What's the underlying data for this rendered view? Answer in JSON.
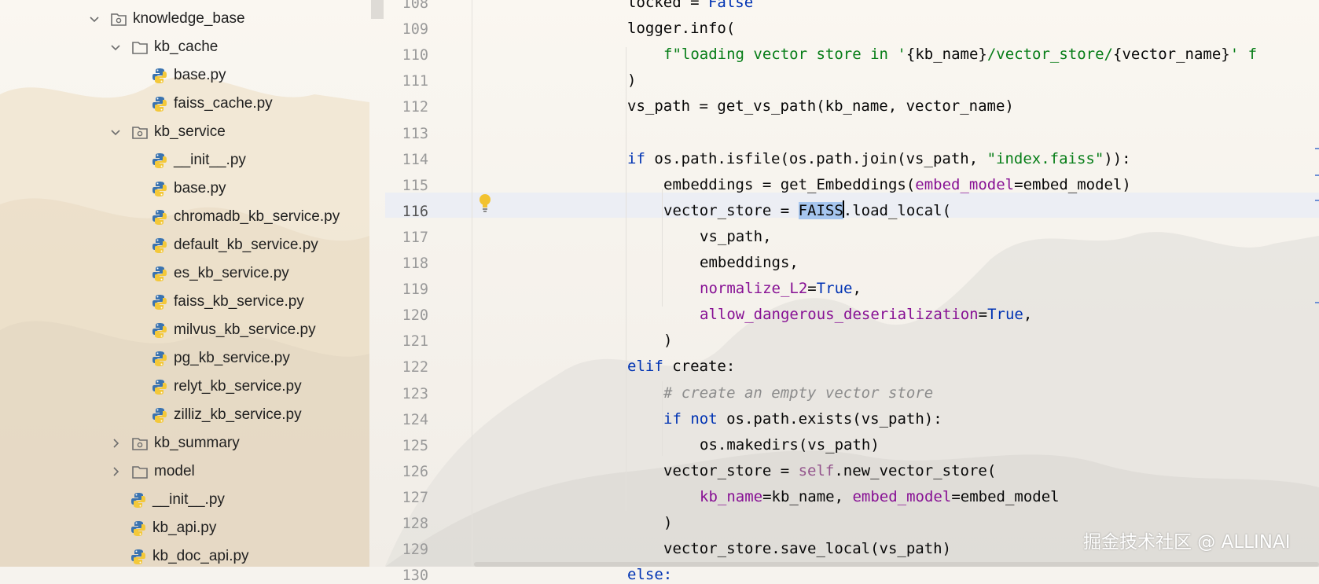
{
  "tree": {
    "items": [
      {
        "label": "knowledge_base",
        "type": "package",
        "chevron": "down"
      },
      {
        "label": "kb_cache",
        "type": "folder",
        "chevron": "down"
      },
      {
        "label": "base.py",
        "type": "python"
      },
      {
        "label": "faiss_cache.py",
        "type": "python"
      },
      {
        "label": "kb_service",
        "type": "package",
        "chevron": "down"
      },
      {
        "label": "__init__.py",
        "type": "python"
      },
      {
        "label": "base.py",
        "type": "python"
      },
      {
        "label": "chromadb_kb_service.py",
        "type": "python"
      },
      {
        "label": "default_kb_service.py",
        "type": "python"
      },
      {
        "label": "es_kb_service.py",
        "type": "python"
      },
      {
        "label": "faiss_kb_service.py",
        "type": "python"
      },
      {
        "label": "milvus_kb_service.py",
        "type": "python"
      },
      {
        "label": "pg_kb_service.py",
        "type": "python"
      },
      {
        "label": "relyt_kb_service.py",
        "type": "python"
      },
      {
        "label": "zilliz_kb_service.py",
        "type": "python"
      },
      {
        "label": "kb_summary",
        "type": "package",
        "chevron": "right"
      },
      {
        "label": "model",
        "type": "folder",
        "chevron": "right"
      },
      {
        "label": "__init__.py",
        "type": "python"
      },
      {
        "label": "kb_api.py",
        "type": "python"
      },
      {
        "label": "kb_doc_api.py",
        "type": "python"
      }
    ]
  },
  "editor": {
    "active_line": "116",
    "lines": [
      {
        "num": "108",
        "segs": [
          [
            "locked = ",
            ""
          ],
          [
            "False",
            "kw"
          ]
        ]
      },
      {
        "num": "109",
        "segs": [
          [
            "logger.info(",
            ""
          ]
        ]
      },
      {
        "num": "110",
        "segs": [
          [
            "f\"loading vector store in '",
            "str"
          ],
          [
            "{",
            ""
          ],
          [
            "kb_name",
            "plain"
          ],
          [
            "}",
            "plain"
          ],
          [
            "/vector_store/",
            "str"
          ],
          [
            "{",
            ""
          ],
          [
            "vector_name",
            "plain"
          ],
          [
            "}",
            "plain"
          ],
          [
            "' f",
            "str"
          ]
        ]
      },
      {
        "num": "111",
        "segs": [
          [
            ")",
            ""
          ]
        ]
      },
      {
        "num": "112",
        "segs": [
          [
            "vs_path = get_vs_path(kb_name, vector_name)",
            ""
          ]
        ]
      },
      {
        "num": "113",
        "segs": []
      },
      {
        "num": "114",
        "segs": [
          [
            "if",
            "kw"
          ],
          [
            " os.path.isfile(os.path.join(vs_path, ",
            ""
          ],
          [
            "\"index.faiss\"",
            "str"
          ],
          [
            ")):",
            ""
          ]
        ]
      },
      {
        "num": "115",
        "segs": [
          [
            "embeddings = get_Embeddings(",
            ""
          ],
          [
            "embed_model",
            "prm"
          ],
          [
            "=embed_model)",
            ""
          ]
        ]
      },
      {
        "num": "116",
        "segs": [
          [
            "vector_store = ",
            ""
          ],
          [
            "FAISS",
            "sel"
          ],
          [
            "|",
            "caret"
          ],
          [
            ".load_local(",
            ""
          ]
        ]
      },
      {
        "num": "117",
        "segs": [
          [
            "vs_path,",
            ""
          ]
        ]
      },
      {
        "num": "118",
        "segs": [
          [
            "embeddings,",
            ""
          ]
        ]
      },
      {
        "num": "119",
        "segs": [
          [
            "normalize_L2",
            "prm"
          ],
          [
            "=",
            ""
          ],
          [
            "True",
            "kw"
          ],
          [
            ",",
            ""
          ]
        ]
      },
      {
        "num": "120",
        "segs": [
          [
            "allow_dangerous_deserialization",
            "prm"
          ],
          [
            "=",
            ""
          ],
          [
            "True",
            "kw"
          ],
          [
            ",",
            ""
          ]
        ]
      },
      {
        "num": "121",
        "segs": [
          [
            ")",
            ""
          ]
        ]
      },
      {
        "num": "122",
        "segs": [
          [
            "elif",
            "kw"
          ],
          [
            " create:",
            ""
          ]
        ]
      },
      {
        "num": "123",
        "segs": [
          [
            "# create an empty vector store",
            "cmt"
          ]
        ]
      },
      {
        "num": "124",
        "segs": [
          [
            "if",
            "kw"
          ],
          [
            " ",
            ""
          ],
          [
            "not",
            "kw"
          ],
          [
            " os.path.exists(vs_path):",
            ""
          ]
        ]
      },
      {
        "num": "125",
        "segs": [
          [
            "os.makedirs(vs_path)",
            ""
          ]
        ]
      },
      {
        "num": "126",
        "segs": [
          [
            "vector_store = ",
            ""
          ],
          [
            "self",
            "self"
          ],
          [
            ".new_vector_store(",
            ""
          ]
        ]
      },
      {
        "num": "127",
        "segs": [
          [
            "kb_name",
            "prm"
          ],
          [
            "=kb_name, ",
            ""
          ],
          [
            "embed_model",
            "prm"
          ],
          [
            "=embed_model",
            ""
          ]
        ]
      },
      {
        "num": "128",
        "segs": [
          [
            ")",
            ""
          ]
        ]
      },
      {
        "num": "129",
        "segs": [
          [
            "vector_store.save_local(vs_path)",
            ""
          ]
        ]
      },
      {
        "num": "130",
        "segs": [
          [
            "else:",
            "kw"
          ]
        ]
      }
    ]
  },
  "watermark": "掘金技术社区 @ ALLINAI",
  "icons": {
    "folder": "folder-icon",
    "package": "package-icon",
    "python": "python-file-icon",
    "bulb": "lightbulb-icon",
    "expanded": "chevron-down-icon",
    "collapsed": "chevron-right-icon"
  },
  "colors": {
    "keyword": "#0033b3",
    "string": "#067d17",
    "param": "#871094",
    "comment": "#8c8c8c",
    "self": "#94558d",
    "selection": "#a6c6ef",
    "python_blue": "#3a73b0",
    "python_yellow": "#f3c83a"
  }
}
